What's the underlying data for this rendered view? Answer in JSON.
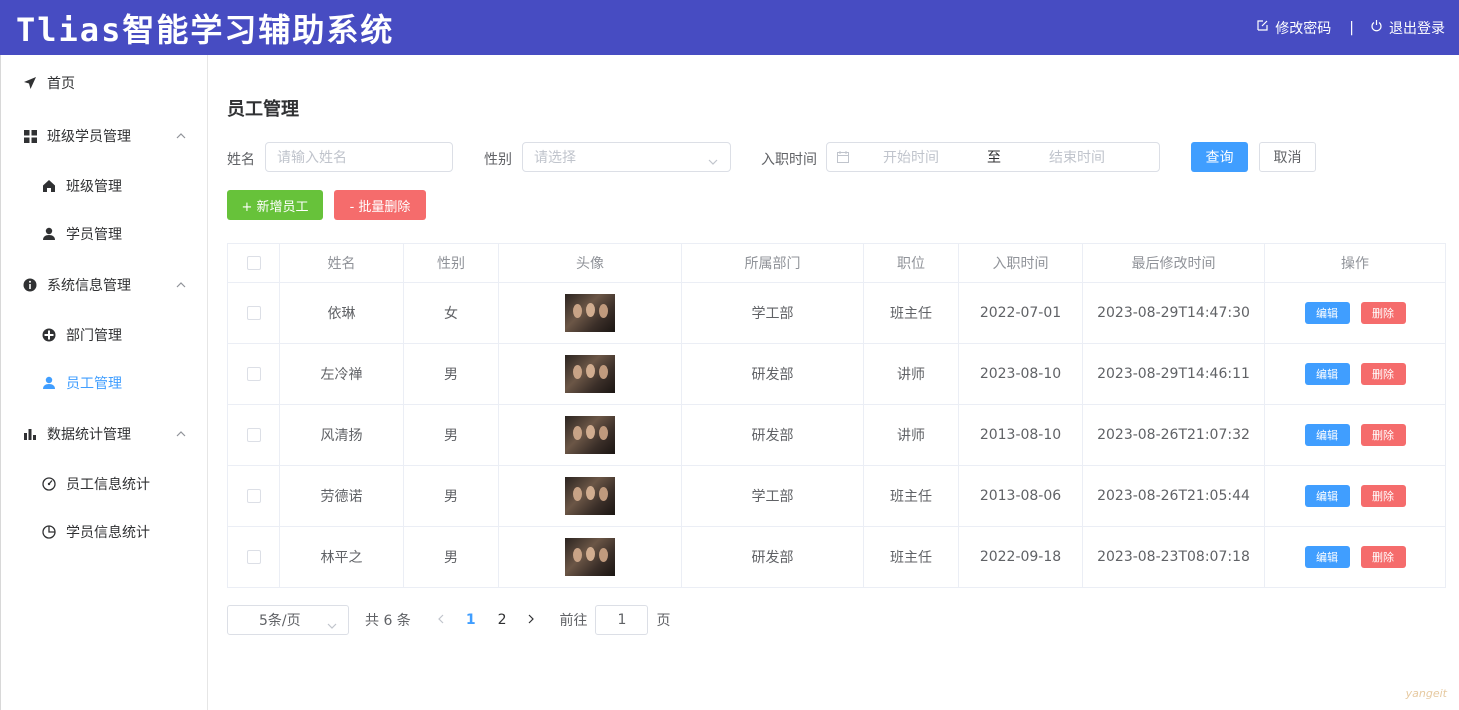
{
  "header": {
    "title": "Tlias智能学习辅助系统",
    "change_password": "修改密码",
    "separator": "|",
    "logout": "退出登录"
  },
  "sidebar": {
    "items": [
      {
        "label": "首页",
        "icon": "paper-plane-icon"
      },
      {
        "label": "班级学员管理",
        "icon": "grid-icon",
        "expanded": true
      },
      {
        "label": "班级管理",
        "icon": "home-icon"
      },
      {
        "label": "学员管理",
        "icon": "user-icon"
      },
      {
        "label": "系统信息管理",
        "icon": "info-icon",
        "expanded": true
      },
      {
        "label": "部门管理",
        "icon": "dept-icon"
      },
      {
        "label": "员工管理",
        "icon": "user-icon",
        "active": true
      },
      {
        "label": "数据统计管理",
        "icon": "bar-chart-icon",
        "expanded": true
      },
      {
        "label": "员工信息统计",
        "icon": "gauge-icon"
      },
      {
        "label": "学员信息统计",
        "icon": "pie-icon"
      }
    ]
  },
  "page": {
    "title": "员工管理"
  },
  "filters": {
    "name_label": "姓名",
    "name_placeholder": "请输入姓名",
    "gender_label": "性别",
    "gender_placeholder": "请选择",
    "date_label": "入职时间",
    "start_placeholder": "开始时间",
    "range_separator": "至",
    "end_placeholder": "结束时间",
    "query_button": "查询",
    "cancel_button": "取消"
  },
  "actions": {
    "add_button": "+ 新增员工",
    "batch_delete_button": "- 批量删除"
  },
  "table": {
    "columns": [
      "姓名",
      "性别",
      "头像",
      "所属部门",
      "职位",
      "入职时间",
      "最后修改时间",
      "操作"
    ],
    "rows": [
      {
        "name": "依琳",
        "gender": "女",
        "dept": "学工部",
        "job": "班主任",
        "entry_date": "2022-07-01",
        "update_time": "2023-08-29T14:47:30"
      },
      {
        "name": "左冷禅",
        "gender": "男",
        "dept": "研发部",
        "job": "讲师",
        "entry_date": "2023-08-10",
        "update_time": "2023-08-29T14:46:11"
      },
      {
        "name": "风清扬",
        "gender": "男",
        "dept": "研发部",
        "job": "讲师",
        "entry_date": "2013-08-10",
        "update_time": "2023-08-26T21:07:32"
      },
      {
        "name": "劳德诺",
        "gender": "男",
        "dept": "学工部",
        "job": "班主任",
        "entry_date": "2013-08-06",
        "update_time": "2023-08-26T21:05:44"
      },
      {
        "name": "林平之",
        "gender": "男",
        "dept": "研发部",
        "job": "班主任",
        "entry_date": "2022-09-18",
        "update_time": "2023-08-23T08:07:18"
      }
    ],
    "edit_label": "编辑",
    "delete_label": "删除"
  },
  "pagination": {
    "page_size": "5条/页",
    "total": "共 6 条",
    "pages": [
      "1",
      "2"
    ],
    "current_page": "1",
    "goto_label": "前往",
    "goto_value": "1",
    "page_unit": "页"
  },
  "watermark": "yangeit",
  "colors": {
    "header_bg": "#474cc2",
    "primary": "#409eff",
    "success": "#67c23a",
    "danger": "#f56c6c"
  }
}
